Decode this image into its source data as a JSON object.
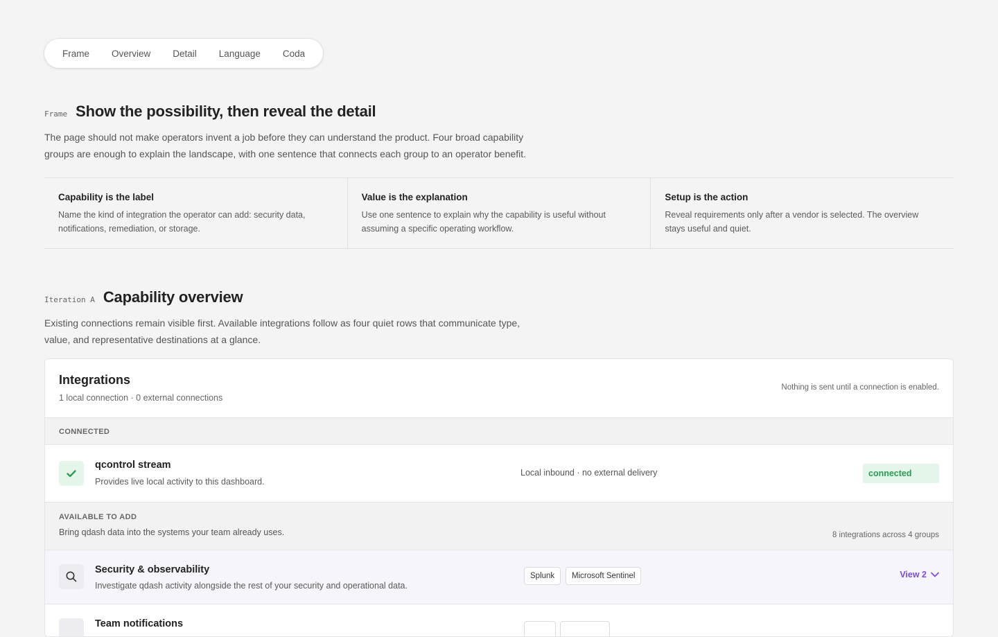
{
  "nav": {
    "items": [
      "Frame",
      "Overview",
      "Detail",
      "Language",
      "Coda"
    ]
  },
  "frame": {
    "eyebrow": "Frame",
    "title": "Show the possibility, then reveal the detail",
    "lead": "The page should not make operators invent a job before they can understand the product. Four broad capability groups are enough to explain the landscape, with one sentence that connects each group to an operator benefit.",
    "principles": [
      {
        "title": "Capability is the label",
        "body": "Name the kind of integration the operator can add: security data, notifications, remediation, or storage."
      },
      {
        "title": "Value is the explanation",
        "body": "Use one sentence to explain why the capability is useful without assuming a specific operating workflow."
      },
      {
        "title": "Setup is the action",
        "body": "Reveal requirements only after a vendor is selected. The overview stays useful and quiet."
      }
    ]
  },
  "iteration": {
    "eyebrow": "Iteration A",
    "title": "Capability overview",
    "lead": "Existing connections remain visible first. Available integrations follow as four quiet rows that communicate type, value, and representative destinations at a glance."
  },
  "panel": {
    "title": "Integrations",
    "subtitle": "1 local connection · 0 external connections",
    "note": "Nothing is sent until a connection is enabled.",
    "connected_label": "CONNECTED",
    "connected_row": {
      "title": "qcontrol stream",
      "desc": "Provides live local activity to this dashboard.",
      "meta": "Local inbound · no external delivery",
      "status": "connected",
      "status_color": "#2f9a55"
    },
    "available_label": "AVAILABLE TO ADD",
    "available_desc": "Bring qdash data into the systems your team already uses.",
    "available_count": "8 integrations across 4 groups",
    "groups": [
      {
        "title": "Security & observability",
        "desc": "Investigate qdash activity alongside the rest of your security and operational data.",
        "vendors": [
          "Splunk",
          "Microsoft Sentinel"
        ],
        "action": "View 2",
        "icon": "search-icon"
      },
      {
        "title": "Team notifications",
        "icon": "bell-icon"
      }
    ],
    "accent_color": "#7c4ddb"
  }
}
